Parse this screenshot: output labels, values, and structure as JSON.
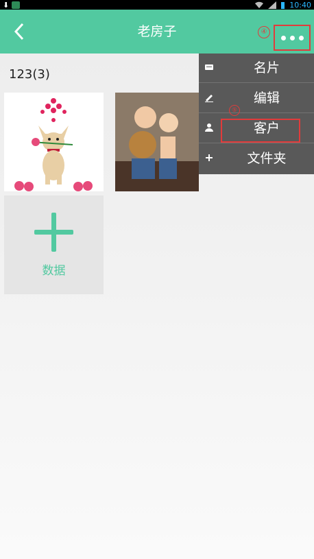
{
  "status_bar": {
    "time": "10:40"
  },
  "app_bar": {
    "title": "老房子"
  },
  "annotations": {
    "step_more": "④",
    "step_menu": "⑤"
  },
  "folder": {
    "label": "123(3)"
  },
  "photos": [
    "dog-with-rose",
    "kids-on-suitcase"
  ],
  "add_tile": {
    "label": "数据"
  },
  "menu": {
    "items": [
      {
        "label": "名片",
        "icon": "card-icon"
      },
      {
        "label": "编辑",
        "icon": "pencil-icon"
      },
      {
        "label": "客户",
        "icon": "person-icon"
      },
      {
        "label": "文件夹",
        "icon": "plus-icon"
      }
    ]
  },
  "colors": {
    "accent": "#52c9a0",
    "menu_bg": "#595959",
    "annotation": "#e23b3b"
  }
}
